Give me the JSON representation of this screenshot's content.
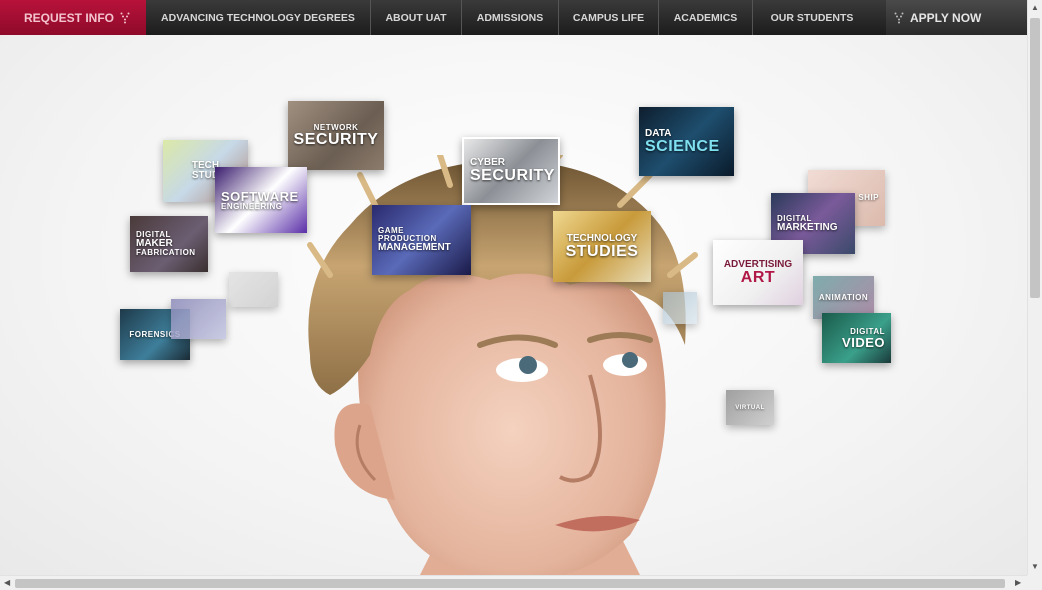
{
  "nav": {
    "request_info": "REQUEST INFO",
    "items": [
      {
        "label": "ADVANCING TECHNOLOGY DEGREES"
      },
      {
        "label": "ABOUT UAT"
      },
      {
        "label": "ADMISSIONS"
      },
      {
        "label": "CAMPUS LIFE"
      },
      {
        "label": "ACADEMICS"
      },
      {
        "label": "OUR STUDENTS"
      }
    ],
    "apply_now": "APPLY NOW"
  },
  "tiles": {
    "network_security": {
      "line1": "NETWORK",
      "line2": "SECURITY"
    },
    "tech_studio": {
      "line1": "TECH",
      "line2": "STUD"
    },
    "software_engineering": {
      "line1": "SOFTWARE",
      "line2": "ENGINEERING"
    },
    "digital_maker": {
      "line1": "DIGITAL",
      "line2": "MAKER",
      "line3": "FABRICATION"
    },
    "cyber_security": {
      "line1": "CYBER",
      "line2": "SECURITY"
    },
    "game_production": {
      "line1": "GAME",
      "line2": "PRODUCTION",
      "line3": "MANAGEMENT"
    },
    "data_science": {
      "line1": "DATA",
      "line2": "SCIENCE"
    },
    "technology_studies": {
      "line1": "TECHNOLOGY",
      "line2": "STUDIES"
    },
    "digital_marketing": {
      "line1": "DIGITAL",
      "line2": "MARKETING"
    },
    "entrepreneurship": {
      "line1": "SHIP"
    },
    "advertising_art": {
      "line1": "ADVERTISING",
      "line2": "ART"
    },
    "animation": {
      "line1": "ANIMATION"
    },
    "digital_video": {
      "line1": "DIGITAL",
      "line2": "VIDEO"
    },
    "forensics": {
      "line1": "FORENSICS"
    },
    "virtual": {
      "line1": "VIRTUAL"
    }
  },
  "colors": {
    "nav_bg": "#1c1c1c",
    "request_bg": "#a3102f",
    "request_text": "#f3c4cf",
    "nav_text": "#d7d7d7"
  },
  "icons": {
    "request_arrow": "chevron-down-arrow-icon",
    "apply_arrow": "chevron-down-arrow-icon",
    "scroll_up": "triangle-up-icon",
    "scroll_down": "triangle-down-icon",
    "scroll_left": "triangle-left-icon",
    "scroll_right": "triangle-right-icon"
  }
}
